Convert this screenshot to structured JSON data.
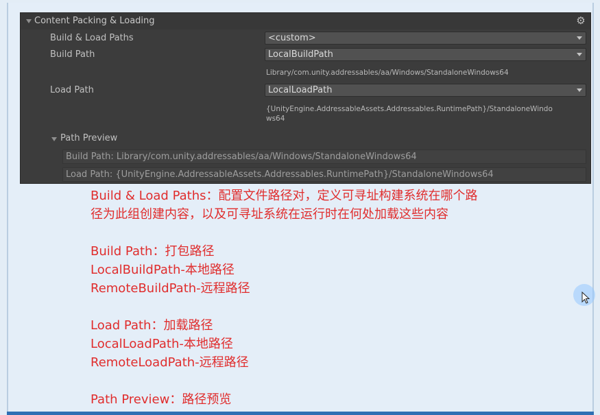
{
  "panel": {
    "title": "Content Packing & Loading",
    "rows": {
      "build_load_paths": {
        "label": "Build & Load Paths",
        "value": "<custom>"
      },
      "build_path": {
        "label": "Build Path",
        "value": "LocalBuildPath",
        "resolved": "Library/com.unity.addressables/aa/Windows/StandaloneWindows64"
      },
      "load_path": {
        "label": "Load Path",
        "value": "LocalLoadPath",
        "resolved_line1": "{UnityEngine.AddressableAssets.Addressables.RuntimePath}/StandaloneWindo",
        "resolved_line2": "ws64"
      }
    },
    "preview": {
      "title": "Path Preview",
      "build": "Build Path: Library/com.unity.addressables/aa/Windows/StandaloneWindows64",
      "load": "Load Path: {UnityEngine.AddressableAssets.Addressables.RuntimePath}/StandaloneWindows64"
    }
  },
  "notes": {
    "line1": "Build & Load Paths：配置文件路径对，定义可寻址构建系统在哪个路",
    "line2": "径为此组创建内容，以及可寻址系统在运行时在何处加载这些内容",
    "line3": "Build Path：打包路径",
    "line4": "LocalBuildPath-本地路径",
    "line5": "RemoteBuildPath-远程路径",
    "line6": "Load Path：加载路径",
    "line7": "LocalLoadPath-本地路径",
    "line8": "RemoteLoadPath-远程路径",
    "line9": "Path Preview：路径预览"
  },
  "icons": {
    "gear": "gear-icon",
    "foldout": "foldout-arrow-icon",
    "dropdown": "dropdown-arrow-icon",
    "cursor": "mouse-cursor-icon"
  },
  "colors": {
    "panel_bg": "#3c3c3c",
    "note_text": "#e02d2d",
    "page_bg": "#e3edf6"
  }
}
